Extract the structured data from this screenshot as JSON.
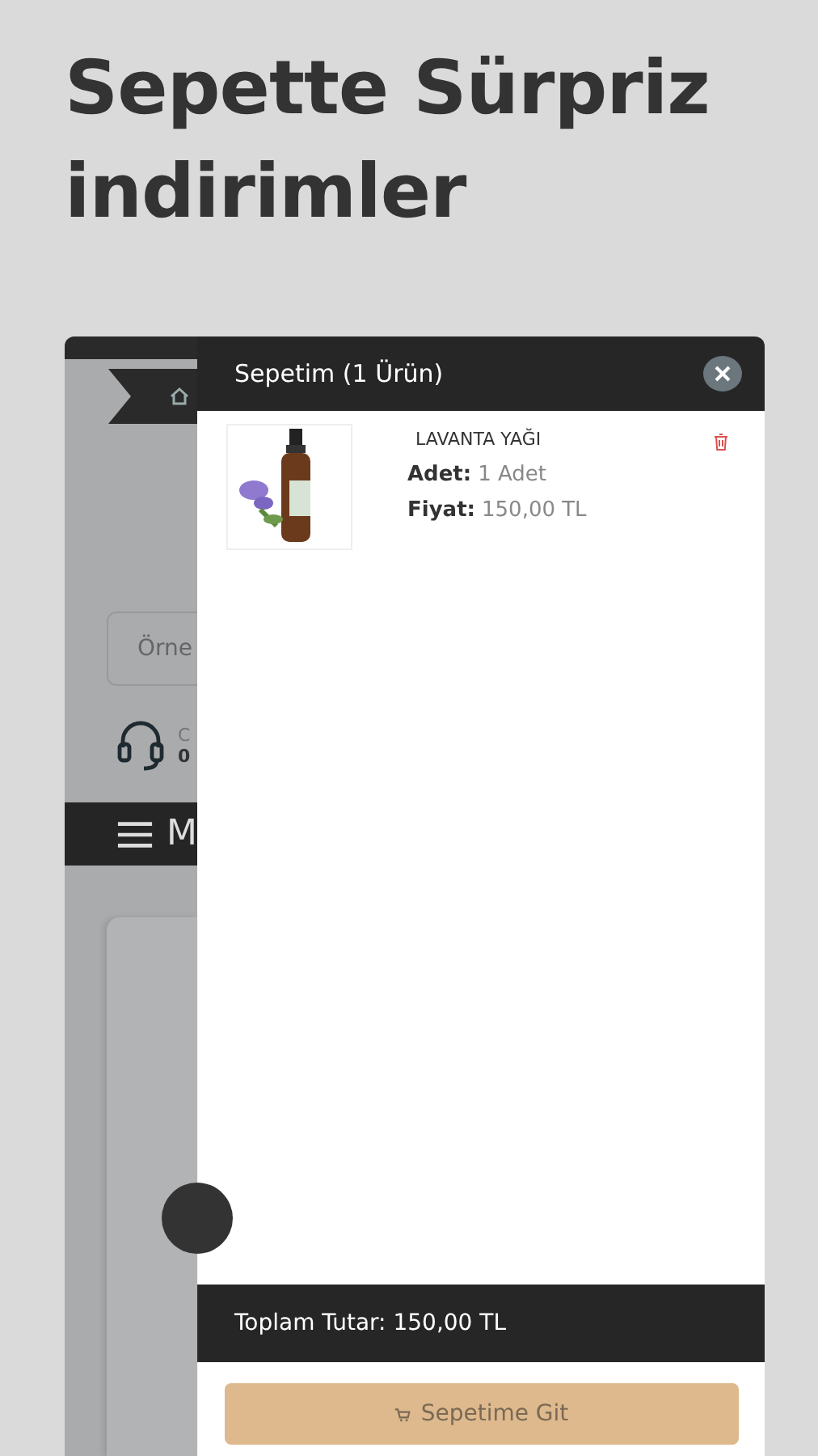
{
  "headline": "Sepette Sürpriz indirimler",
  "background_app": {
    "search": {
      "placeholder": "Örne"
    },
    "support": {
      "line_1": "C",
      "line_2": "0"
    },
    "menu": {
      "label": "M"
    }
  },
  "cart": {
    "title": "Sepetim (1 Ürün)",
    "items": [
      {
        "name": "LAVANTA YAĞI",
        "quantity_label": "Adet:",
        "quantity": "1 Adet",
        "price_label": "Fiyat:",
        "price": "150,00 TL"
      }
    ],
    "total": "Toplam Tutar: 150,00 TL",
    "button": "Sepetime Git"
  }
}
